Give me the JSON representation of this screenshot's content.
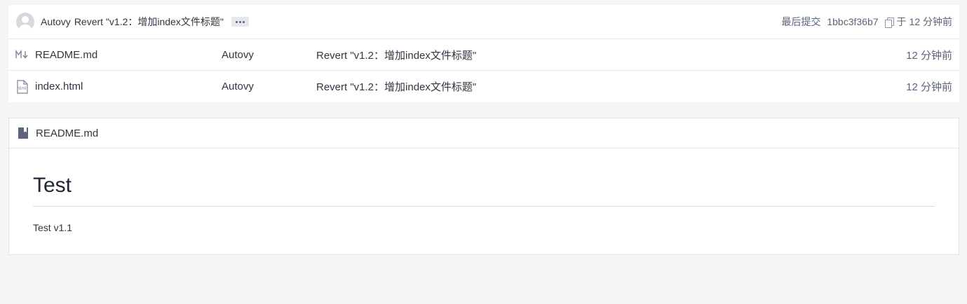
{
  "latest_commit": {
    "author": "Autovy",
    "message": "Revert \"v1.2：增加index文件标题\"",
    "label": "最后提交",
    "sha": "1bbc3f36b7",
    "time_prefix": "于",
    "time": "12 分钟前"
  },
  "files": [
    {
      "name": "README.md",
      "icon": "markdown-icon",
      "author": "Autovy",
      "message": "Revert \"v1.2：增加index文件标题\"",
      "time": "12 分钟前"
    },
    {
      "name": "index.html",
      "icon": "html-file-icon",
      "author": "Autovy",
      "message": "Revert \"v1.2：增加index文件标题\"",
      "time": "12 分钟前"
    }
  ],
  "readme": {
    "icon": "book-icon",
    "filename": "README.md",
    "heading": "Test",
    "paragraph": "Test v1.1"
  },
  "colors": {
    "background": "#f5f5f5",
    "text": "#303643",
    "muted": "#5b6478"
  }
}
